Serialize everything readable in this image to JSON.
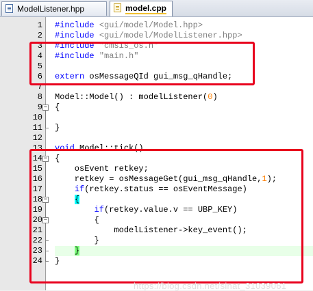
{
  "tabs": [
    {
      "label": "ModelListener.hpp",
      "active": false
    },
    {
      "label": "model.cpp",
      "active": true
    }
  ],
  "lines": [
    {
      "n": "1",
      "segs": [
        {
          "t": "#include ",
          "c": "kw"
        },
        {
          "t": "<gui/model/Model.hpp>",
          "c": "str"
        }
      ]
    },
    {
      "n": "2",
      "segs": [
        {
          "t": "#include ",
          "c": "kw"
        },
        {
          "t": "<gui/model/ModelListener.hpp>",
          "c": "str"
        }
      ]
    },
    {
      "n": "3",
      "segs": [
        {
          "t": "#include ",
          "c": "kw"
        },
        {
          "t": "\"cmsis_os.h\"",
          "c": "str"
        }
      ]
    },
    {
      "n": "4",
      "segs": [
        {
          "t": "#include ",
          "c": "kw"
        },
        {
          "t": "\"main.h\"",
          "c": "str"
        }
      ]
    },
    {
      "n": "5",
      "segs": []
    },
    {
      "n": "6",
      "segs": [
        {
          "t": "extern",
          "c": "kw"
        },
        {
          "t": " osMessageQId gui_msg_qHandle;",
          "c": ""
        }
      ]
    },
    {
      "n": "7",
      "segs": []
    },
    {
      "n": "8",
      "segs": [
        {
          "t": "Model::Model() : modelListener(",
          "c": ""
        },
        {
          "t": "0",
          "c": "num"
        },
        {
          "t": ")",
          "c": ""
        }
      ]
    },
    {
      "n": "9",
      "segs": [
        {
          "t": "{",
          "c": ""
        }
      ]
    },
    {
      "n": "10",
      "segs": []
    },
    {
      "n": "11",
      "segs": [
        {
          "t": "}",
          "c": ""
        }
      ]
    },
    {
      "n": "12",
      "segs": []
    },
    {
      "n": "13",
      "segs": [
        {
          "t": "void",
          "c": "kw"
        },
        {
          "t": " Model::tick()",
          "c": ""
        }
      ]
    },
    {
      "n": "14",
      "segs": [
        {
          "t": "{",
          "c": ""
        }
      ]
    },
    {
      "n": "15",
      "segs": [
        {
          "t": "    osEvent retkey;",
          "c": ""
        }
      ]
    },
    {
      "n": "16",
      "segs": [
        {
          "t": "    retkey = osMessageGet(gui_msg_qHandle,",
          "c": ""
        },
        {
          "t": "1",
          "c": "num"
        },
        {
          "t": ");",
          "c": ""
        }
      ]
    },
    {
      "n": "17",
      "segs": [
        {
          "t": "    ",
          "c": ""
        },
        {
          "t": "if",
          "c": "kw"
        },
        {
          "t": "(retkey.status == osEventMessage)",
          "c": ""
        }
      ]
    },
    {
      "n": "18",
      "segs": [
        {
          "t": "    ",
          "c": ""
        },
        {
          "t": "{",
          "c": "brace-hl cyan"
        }
      ]
    },
    {
      "n": "19",
      "segs": [
        {
          "t": "        ",
          "c": ""
        },
        {
          "t": "if",
          "c": "kw"
        },
        {
          "t": "(retkey.value.v == UBP_KEY)",
          "c": ""
        }
      ]
    },
    {
      "n": "20",
      "segs": [
        {
          "t": "        {",
          "c": ""
        }
      ]
    },
    {
      "n": "21",
      "segs": [
        {
          "t": "            modelListener->key_event();",
          "c": ""
        }
      ]
    },
    {
      "n": "22",
      "segs": [
        {
          "t": "        }",
          "c": ""
        }
      ]
    },
    {
      "n": "23",
      "segs": [
        {
          "t": "    ",
          "c": ""
        },
        {
          "t": "}",
          "c": "brace-hl"
        }
      ]
    },
    {
      "n": "24",
      "segs": [
        {
          "t": "}",
          "c": ""
        }
      ]
    }
  ],
  "watermark": "https://blog.csdn.net/sinat_31039061"
}
